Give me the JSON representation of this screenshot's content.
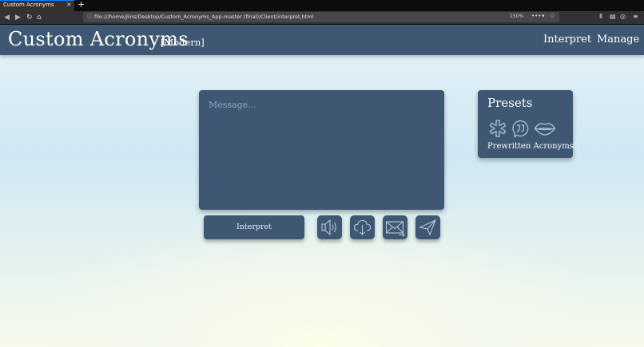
{
  "browser": {
    "tab_title": "Custom Acronyms",
    "tab_close": "×",
    "new_tab": "+",
    "url": "file:///home/jlins/Desktop/Custom_Acronyms_App-master (final)/Client/interpret.html",
    "zoom": "150%",
    "overflow": "•••",
    "icons": [
      "back-icon",
      "forward-icon",
      "reload-icon",
      "home-icon",
      "info-icon",
      "pocket-icon",
      "bookmark-star-icon",
      "library-icon",
      "sidebar-icon",
      "account-icon",
      "menu-icon"
    ]
  },
  "header": {
    "title": "Custom Acronyms",
    "subtitle": "[Modern]",
    "nav": [
      "Interpret",
      "Manage"
    ]
  },
  "message": {
    "placeholder": "Message..."
  },
  "actions": {
    "interpret_label": "Interpret",
    "icons": [
      "speaker-icon",
      "cloud-download-icon",
      "email-icon",
      "send-icon"
    ]
  },
  "presets": {
    "title": "Presets",
    "icons": [
      "asterisk-icon",
      "quote-bubble-icon",
      "lips-icon"
    ],
    "caption": "Prewritten Acronyms!"
  },
  "colors": {
    "panel": "#3e5873",
    "icon_stroke": "#b7c8db"
  }
}
